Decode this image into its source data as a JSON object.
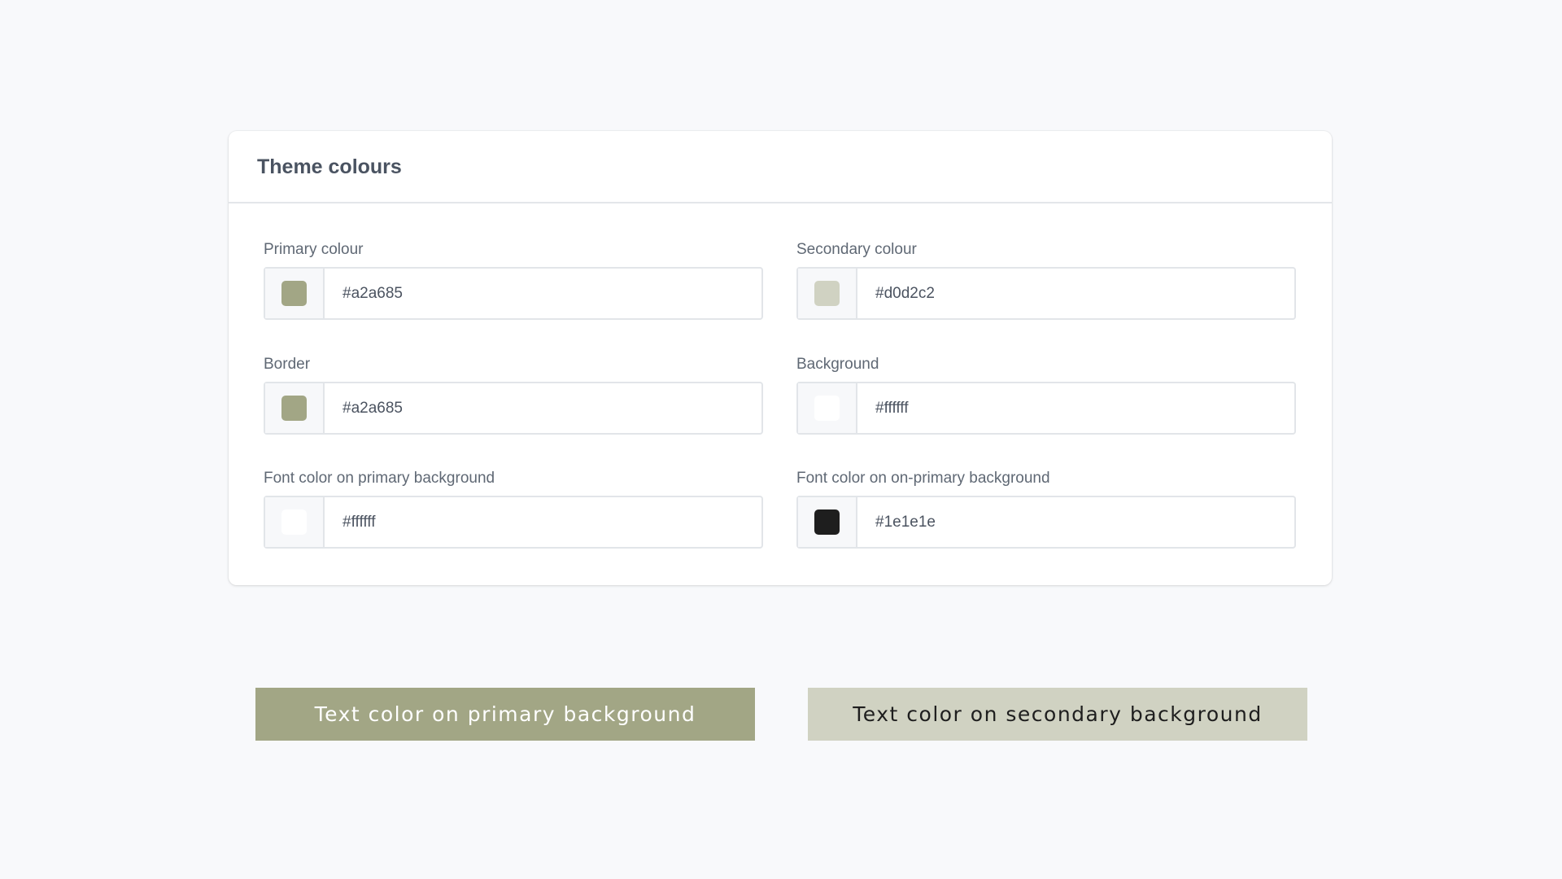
{
  "card": {
    "title": "Theme colours",
    "fields": [
      {
        "label": "Primary colour",
        "value": "#a2a685",
        "swatch": "#a2a685"
      },
      {
        "label": "Secondary colour",
        "value": "#d0d2c2",
        "swatch": "#d0d2c2"
      },
      {
        "label": "Border",
        "value": "#a2a685",
        "swatch": "#a2a685"
      },
      {
        "label": "Background",
        "value": "#ffffff",
        "swatch": "#ffffff"
      },
      {
        "label": "Font color on primary background",
        "value": "#ffffff",
        "swatch": "#ffffff"
      },
      {
        "label": "Font color on on-primary background",
        "value": "#1e1e1e",
        "swatch": "#1e1e1e"
      }
    ]
  },
  "previews": {
    "primary": {
      "text": "Text color on primary background",
      "background": "#a2a685",
      "color": "#ffffff"
    },
    "secondary": {
      "text": "Text color on secondary background",
      "background": "#d0d2c2",
      "color": "#1e1e1e"
    }
  }
}
